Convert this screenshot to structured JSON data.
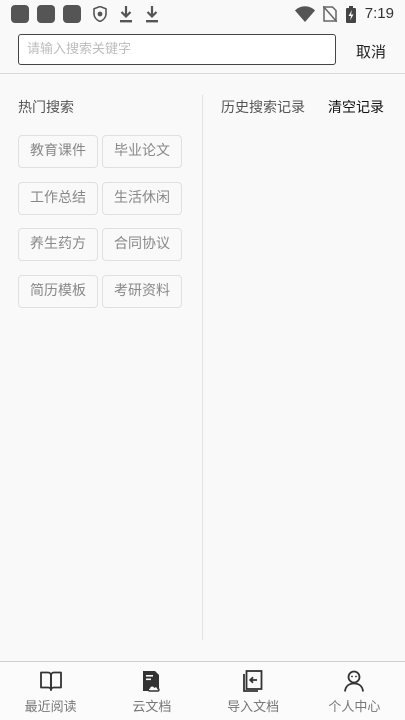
{
  "status_bar": {
    "time": "7:19",
    "left_icons": [
      "app-icon",
      "app-icon",
      "app-icon",
      "shield-icon",
      "download-icon",
      "download-icon"
    ],
    "right_icons": [
      "wifi-icon",
      "no-sim-icon",
      "battery-charging-icon"
    ]
  },
  "search": {
    "placeholder": "请输入搜索关键字",
    "value": "",
    "cancel_label": "取消"
  },
  "hot_search": {
    "title": "热门搜索",
    "tags": [
      "教育课件",
      "毕业论文",
      "工作总结",
      "生活休闲",
      "养生药方",
      "合同协议",
      "简历模板",
      "考研资料"
    ]
  },
  "history": {
    "title": "历史搜索记录",
    "clear_label": "清空记录"
  },
  "bottom_nav": {
    "items": [
      {
        "label": "最近阅读",
        "icon": "open-book-icon"
      },
      {
        "label": "云文档",
        "icon": "cloud-document-icon"
      },
      {
        "label": "导入文档",
        "icon": "import-document-icon"
      },
      {
        "label": "个人中心",
        "icon": "person-icon"
      }
    ]
  }
}
